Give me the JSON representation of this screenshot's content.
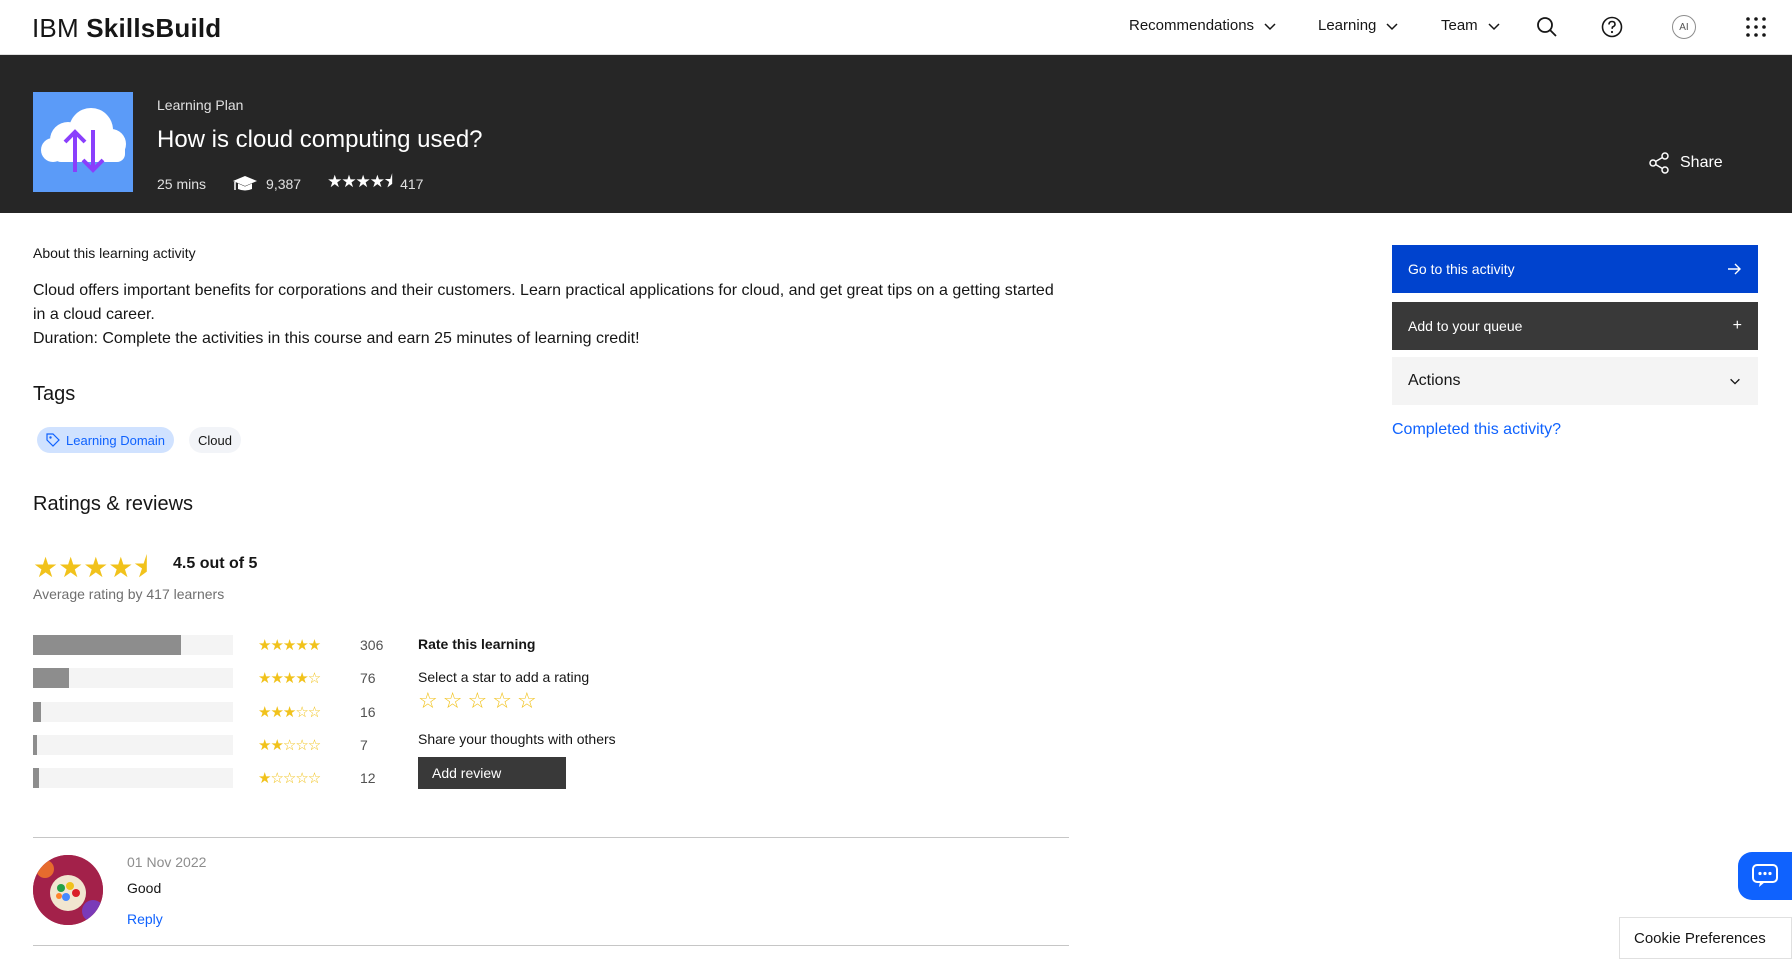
{
  "brand": {
    "prefix": "IBM",
    "name": "SkillsBuild"
  },
  "nav": {
    "items": [
      {
        "label": "Recommendations"
      },
      {
        "label": "Learning"
      },
      {
        "label": "Team"
      }
    ],
    "avatar_initials": "AI"
  },
  "hero": {
    "type": "Learning Plan",
    "title": "How is cloud computing used?",
    "duration": "25 mins",
    "enrolled": "9,387",
    "rating_stars": "★★★★⯨",
    "rating_count": "417",
    "share_label": "Share"
  },
  "about": {
    "heading": "About this learning activity",
    "line1": "Cloud offers important benefits for corporations and their customers. Learn practical applications for cloud, and get great tips on a getting started in a cloud career.",
    "line2": "Duration: Complete the activities in this course and earn 25 minutes of learning credit!"
  },
  "tags": {
    "heading": "Tags",
    "items": [
      "Learning Domain",
      "Cloud"
    ]
  },
  "ratings": {
    "heading": "Ratings & reviews",
    "average_stars": "★★★★⯨",
    "out_of": "4.5 out of 5",
    "average_by": "Average rating by 417 learners",
    "distribution": [
      {
        "stars": "★★★★★",
        "count": "306",
        "fraction": 0.74
      },
      {
        "stars": "★★★★☆",
        "count": "76",
        "fraction": 0.18
      },
      {
        "stars": "★★★☆☆",
        "count": "16",
        "fraction": 0.04
      },
      {
        "stars": "★★☆☆☆",
        "count": "7",
        "fraction": 0.017
      },
      {
        "stars": "★☆☆☆☆",
        "count": "12",
        "fraction": 0.029
      }
    ],
    "rate_title": "Rate this learning",
    "rate_select": "Select a star to add a rating",
    "rate_share": "Share your thoughts with others",
    "add_review": "Add review"
  },
  "review": {
    "date": "01 Nov 2022",
    "text": "Good",
    "reply": "Reply"
  },
  "sidebar": {
    "go_label": "Go to this activity",
    "queue_label": "Add to your queue",
    "queue_icon": "+",
    "actions_label": "Actions",
    "completed_label": "Completed this activity?"
  },
  "cookie_label": "Cookie Preferences",
  "colors": {
    "accent_blue": "#0043ce",
    "link_blue": "#0f62fe",
    "star_yellow": "#f1c21b",
    "hero_bg": "#262626"
  }
}
